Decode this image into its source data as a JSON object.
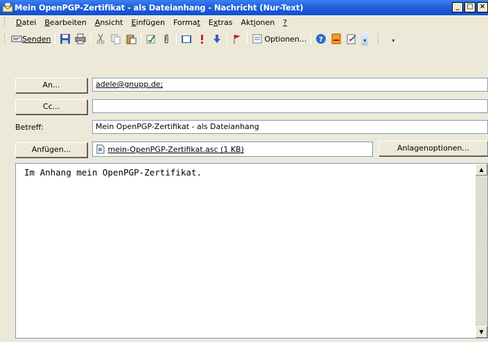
{
  "window": {
    "title": "Mein OpenPGP-Zertifikat - als Dateianhang - Nachricht (Nur-Text)",
    "minimize": "_",
    "maximize": "□",
    "close": "×"
  },
  "menu": [
    {
      "pre": "",
      "ul": "D",
      "post": "atei"
    },
    {
      "pre": "",
      "ul": "B",
      "post": "earbeiten"
    },
    {
      "pre": "",
      "ul": "A",
      "post": "nsicht"
    },
    {
      "pre": "",
      "ul": "E",
      "post": "infügen"
    },
    {
      "pre": "Forma",
      "ul": "t",
      "post": ""
    },
    {
      "pre": "E",
      "ul": "x",
      "post": "tras"
    },
    {
      "pre": "Akt",
      "ul": "i",
      "post": "onen"
    },
    {
      "pre": "",
      "ul": "?",
      "post": ""
    }
  ],
  "toolbar": {
    "send_label": "Senden",
    "options_label": "Optionen..."
  },
  "form": {
    "to_button": "An...",
    "to_value": "adele@gnupp.de;",
    "cc_button": "Cc...",
    "cc_value": "",
    "subject_label": "Betreff:",
    "subject_value": "Mein OpenPGP-Zertifikat - als Dateianhang",
    "attach_button": "Anfügen...",
    "attachment": "mein-OpenPGP-Zertifikat.asc (1 KB)",
    "attach_options_button": "Anlagenoptionen..."
  },
  "body": {
    "text": "Im Anhang mein OpenPGP-Zertifikat."
  },
  "colors": {
    "titlebar": "#0f4fcf",
    "face": "#ece9d8"
  }
}
